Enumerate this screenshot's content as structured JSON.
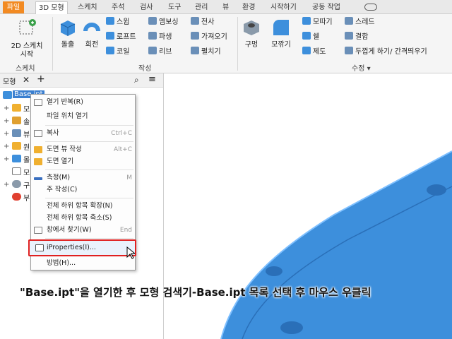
{
  "menubar": {
    "tabs": [
      "파일",
      "3D 모형",
      "스케치",
      "주석",
      "검사",
      "도구",
      "관리",
      "뷰",
      "환경",
      "시작하기",
      "공동 작업"
    ],
    "active": "3D 모형"
  },
  "ribbon": {
    "sketch": {
      "label": "2D 스케치\n시작",
      "group": "스케치"
    },
    "create": {
      "group": "작성",
      "extrude": "돌출",
      "revolve": "회전",
      "sweep": "스윕",
      "loft": "로프트",
      "coil": "코일",
      "emboss": "엠보싱",
      "derive": "파생",
      "rib": "리브",
      "decal": "전사",
      "import": "가져오기",
      "unwrap": "펼치기"
    },
    "modify": {
      "group": "수정",
      "hole": "구멍",
      "fillet": "모깎기",
      "chamfer": "모따기",
      "shell": "쉘",
      "draft": "제도",
      "thread": "스레드",
      "combine": "결합",
      "thicken": "두껍게 하기/ 간격띄우기"
    }
  },
  "browser": {
    "tab": "모형",
    "add": "+",
    "root": "Base.ipt",
    "items": [
      "모",
      "솔",
      "뷰",
      "원",
      "몰",
      "모",
      "구",
      "부"
    ]
  },
  "context_menu": {
    "items": [
      {
        "label": "열기 반복(R)",
        "shortcut": ""
      },
      {
        "label": "파일 위치 열기",
        "shortcut": ""
      },
      {
        "label": "복사",
        "shortcut": "Ctrl+C"
      },
      {
        "label": "도면 뷰 작성",
        "shortcut": "Alt+C"
      },
      {
        "label": "도면 열기",
        "shortcut": ""
      },
      {
        "label": "측정(M)",
        "shortcut": "M"
      },
      {
        "label": "주 작성(C)",
        "shortcut": ""
      },
      {
        "label": "전체 하위 항목 확장(N)",
        "shortcut": ""
      },
      {
        "label": "전체 하위 항목 축소(S)",
        "shortcut": ""
      },
      {
        "label": "창에서 찾기(W)",
        "shortcut": "End"
      },
      {
        "label": "iProperties(I)...",
        "shortcut": ""
      },
      {
        "label": "방법(H)...",
        "shortcut": ""
      }
    ],
    "highlight_color": "#e02020"
  },
  "caption": "\"Base.ipt\"을 열기한 후 모형 검색기-Base.ipt 목록 선택 후 마우스 우클릭",
  "colors": {
    "part": "#3d8fdc",
    "file_tab": "#f28a22"
  }
}
